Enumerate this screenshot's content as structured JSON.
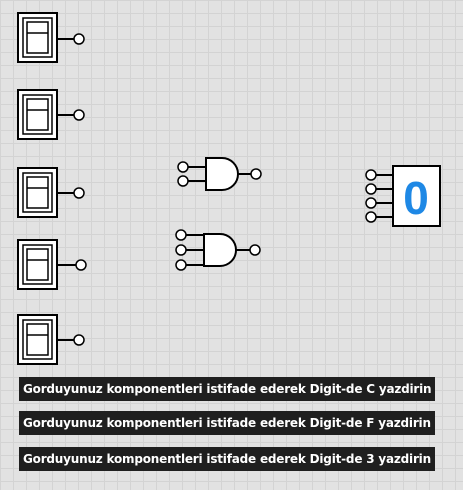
{
  "workspace": {
    "switches": [
      {
        "state": "off"
      },
      {
        "state": "off"
      },
      {
        "state": "off"
      },
      {
        "state": "off"
      },
      {
        "state": "off"
      }
    ],
    "gates": [
      {
        "type": "and",
        "inputs": 2
      },
      {
        "type": "and",
        "inputs": 3
      }
    ],
    "display": {
      "value": "0",
      "inputs": 4,
      "color": "#1e88e5"
    }
  },
  "instructions": [
    {
      "text": "Gorduyunuz komponentleri istifade ederek Digit-de C yazdirin"
    },
    {
      "text": "Gorduyunuz komponentleri istifade ederek Digit-de F yazdirin"
    },
    {
      "text": "Gorduyunuz komponentleri istifade ederek Digit-de 3 yazdirin"
    }
  ]
}
